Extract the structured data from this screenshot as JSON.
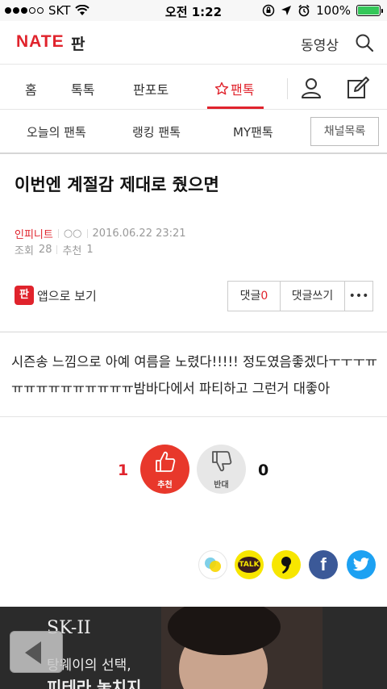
{
  "status_bar": {
    "carrier": "SKT",
    "time": "오전 1:22",
    "battery": "100%"
  },
  "header": {
    "logo": "NATE",
    "section": "판",
    "video_label": "동영상"
  },
  "nav": {
    "items": [
      "홈",
      "톡톡",
      "판포토",
      "팬톡"
    ],
    "active": "팬톡"
  },
  "subnav": {
    "items": [
      "오늘의 팬톡",
      "랭킹 팬톡",
      "MY팬톡"
    ],
    "channel_button": "채널목록"
  },
  "article": {
    "title": "이번엔 계절감 제대로 줬으면",
    "author": "인피니트",
    "author_sub": "○○",
    "date": "2016.06.22 23:21",
    "views_label": "조회",
    "views": "28",
    "recommend_label": "추천",
    "recommend": "1",
    "app_view_label": "앱으로 보기",
    "comment_label": "댓글",
    "comment_count": "0",
    "write_comment_label": "댓글쓰기",
    "more_label": "•••",
    "body": "시즌송 느낌으로 아예 여름을 노렸다!!!!! 정도였음좋겠다ㅜㅜㅜㅠㅠㅠㅠㅠㅠㅠㅠㅠㅠㅠ밤바다에서 파티하고 그런거 대좋아"
  },
  "votes": {
    "up_count": "1",
    "up_label": "추천",
    "down_label": "반대",
    "down_count": "0"
  },
  "share": {
    "kakaotalk_label": "TALK",
    "facebook_label": "f"
  },
  "ad": {
    "brand": "SK-II",
    "line1": "탕웨이의 선택,",
    "line2": "피테라 놓치지"
  },
  "colors": {
    "brand_red": "#e0232c",
    "vote_red": "#e8382b",
    "facebook": "#3b5998",
    "twitter": "#1da1f2",
    "kakao_yellow": "#f7e600"
  }
}
